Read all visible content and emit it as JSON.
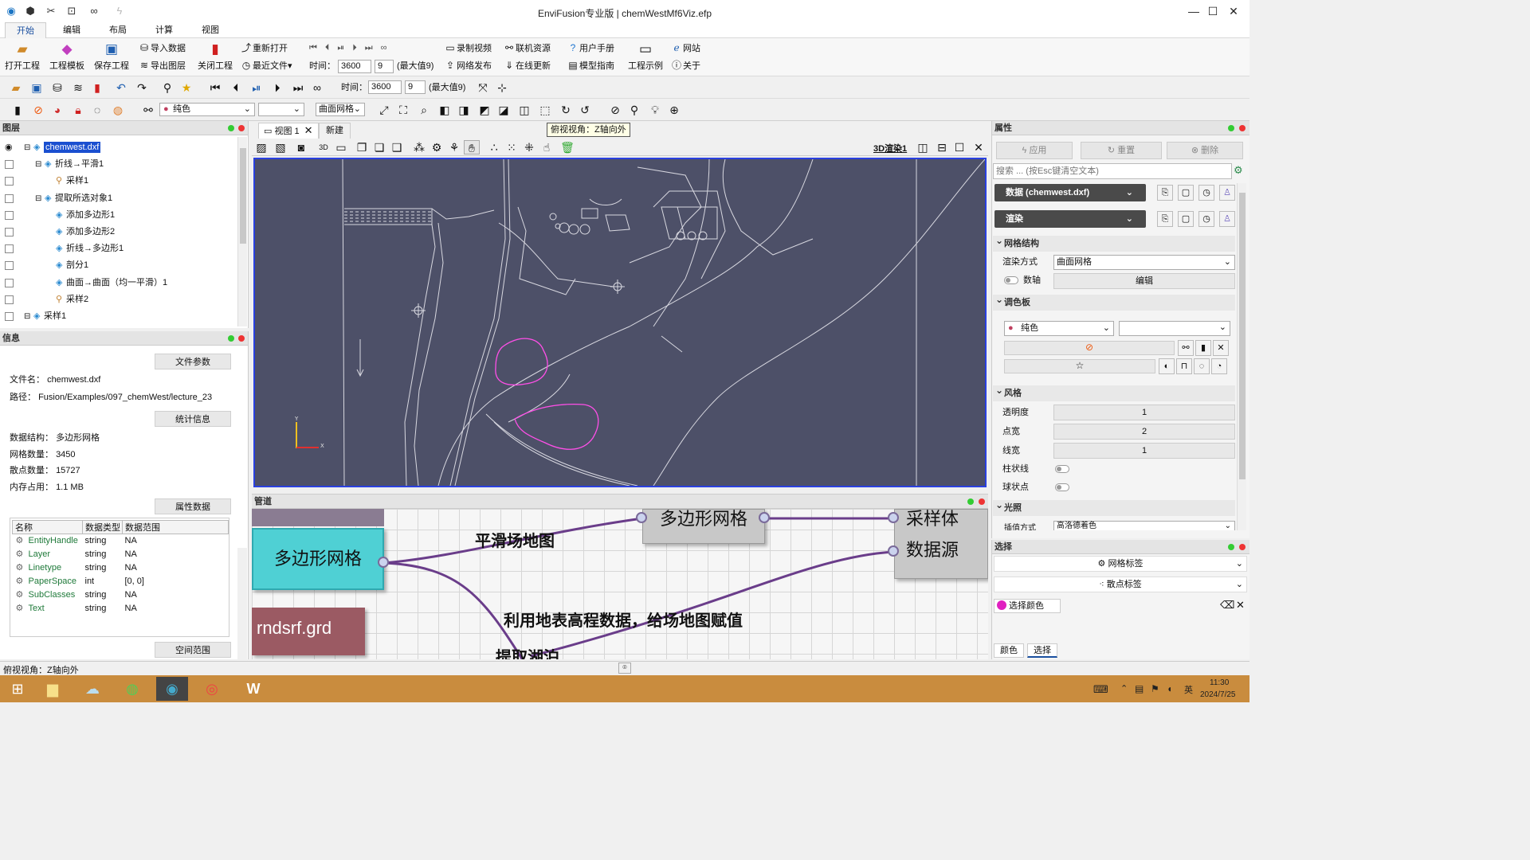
{
  "window": {
    "title": "EnviFusion专业版 | chemWestMf6Viz.efp"
  },
  "menu": [
    "开始",
    "编辑",
    "布局",
    "计算",
    "视图"
  ],
  "ribbon": {
    "open_project": "打开工程",
    "project_template": "工程模板",
    "save_project": "保存工程",
    "import_data": "导入数据",
    "export_layer": "导出图层",
    "close_project": "关闭工程",
    "reopen": "重新打开",
    "recent_files": "最近文件",
    "time_label": "时间：",
    "time_value": "3600",
    "step_value": "9",
    "max_label": "(最大值9)",
    "record_video": "录制视频",
    "network_publish": "网络发布",
    "online_resources": "联机资源",
    "online_update": "在线更新",
    "user_manual": "用户手册",
    "model_guide": "模型指南",
    "project_examples": "工程示例",
    "website": "网站",
    "about": "关于"
  },
  "toolbar2": {
    "time_label": "时间：",
    "time_value": "3600",
    "step_value": "9",
    "max_label": "(最大值9)"
  },
  "toolbar3": {
    "color_mode": "纯色",
    "render_mode": "曲面网格"
  },
  "layers": {
    "title": "图层",
    "items": [
      {
        "label": "chemwest.dxf",
        "indent": 0
      },
      {
        "label": "折线→平滑1",
        "indent": 1
      },
      {
        "label": "采样1",
        "indent": 2
      },
      {
        "label": "提取所选对象1",
        "indent": 1
      },
      {
        "label": "添加多边形1",
        "indent": 2
      },
      {
        "label": "添加多边形2",
        "indent": 2
      },
      {
        "label": "折线→多边形1",
        "indent": 2
      },
      {
        "label": "剖分1",
        "indent": 2
      },
      {
        "label": "曲面→曲面（均一平滑）1",
        "indent": 2
      },
      {
        "label": "采样2",
        "indent": 2
      },
      {
        "label": "采样1",
        "indent": 0
      }
    ]
  },
  "info": {
    "title": "信息",
    "file_params": "文件参数",
    "file_name_label": "文件名：",
    "file_name": "chemwest.dxf",
    "path_label": "路径：",
    "path": "Fusion/Examples/097_chemWest/lecture_23",
    "stats": "统计信息",
    "structure_label": "数据结构：",
    "structure": "多边形网格",
    "cells_label": "网格数量：",
    "cells": "3450",
    "points_label": "散点数量：",
    "points": "15727",
    "memory_label": "内存占用：",
    "memory": "1.1 MB",
    "attr_data": "属性数据",
    "columns": [
      "名称",
      "数据类型",
      "数据范围"
    ],
    "rows": [
      [
        "EntityHandle",
        "string",
        "NA"
      ],
      [
        "Layer",
        "string",
        "NA"
      ],
      [
        "Linetype",
        "string",
        "NA"
      ],
      [
        "PaperSpace",
        "int",
        "[0, 0]"
      ],
      [
        "SubClasses",
        "string",
        "NA"
      ],
      [
        "Text",
        "string",
        "NA"
      ]
    ],
    "spatial_range": "空间范围"
  },
  "view": {
    "tab1": "视图 1",
    "tab2": "新建",
    "tooltip": "俯视视角：Z轴向外",
    "render_label": "3D渲染1",
    "axis_y": "Y",
    "axis_x": "X"
  },
  "pipeline": {
    "title": "管道",
    "node_poly_main": "多边形网格",
    "node_poly_top": "多边形网格",
    "node_sampler": "采样体",
    "node_source": "数据源",
    "node_grd": "rndsrf.grd",
    "label_smooth": "平滑场地图",
    "label_elevation": "利用地表高程数据，给场地图赋值",
    "label_lake": "提取湖泊"
  },
  "properties": {
    "title": "属性",
    "apply": "应用",
    "reset": "重置",
    "delete": "删除",
    "search_placeholder": "搜索 ... (按Esc键清空文本)",
    "data_btn": "数据 (chemwest.dxf)",
    "render_btn": "渲染",
    "mesh_group": "网格结构",
    "render_mode_label": "渲染方式",
    "render_mode": "曲面网格",
    "axis_label": "数轴",
    "edit": "编辑",
    "palette_group": "调色板",
    "palette": "纯色",
    "style_group": "风格",
    "opacity_label": "透明度",
    "opacity": "1",
    "point_width_label": "点宽",
    "point_width": "2",
    "line_width_label": "线宽",
    "line_width": "1",
    "tube_label": "柱状线",
    "sphere_label": "球状点",
    "light_group": "光照",
    "interp_label": "插值方式",
    "interp": "高洛德着色"
  },
  "selection": {
    "title": "选择",
    "mesh_label": "网格标签",
    "point_label": "散点标签",
    "sel_color": "选择颜色",
    "tab_color": "颜色",
    "tab_select": "选择"
  },
  "status": {
    "text": "俯视视角：Z轴向外"
  },
  "taskbar": {
    "time": "11:30",
    "date": "2024/7/25",
    "ime": "英"
  },
  "colors": {
    "viewport": "#4d5068",
    "node_teal": "#4fd0d4",
    "node_grd": "#9b5a63",
    "curve": "#6a3d8a",
    "accent": "#1a4fa0"
  }
}
